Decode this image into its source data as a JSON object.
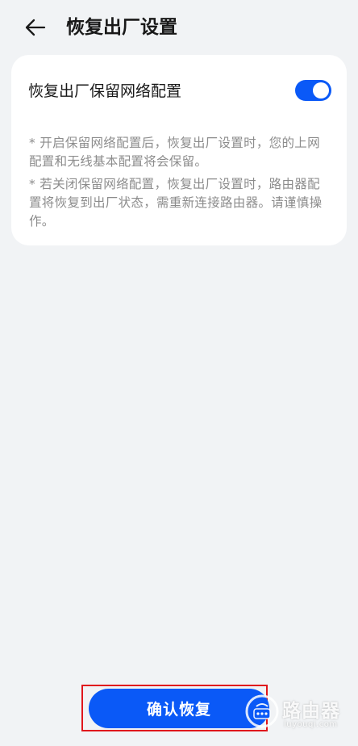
{
  "header": {
    "title": "恢复出厂设置",
    "back_icon": "arrow-left-icon"
  },
  "settings": {
    "keep_network_label": "恢复出厂保留网络配置",
    "keep_network_enabled": true,
    "note_on": "* 开启保留网络配置后，恢复出厂设置时，您的上网配置和无线基本配置将会保留。",
    "note_off": "* 若关闭保留网络配置，恢复出厂设置时，路由器配置将恢复到出厂状态，需重新连接路由器。请谨慎操作。"
  },
  "actions": {
    "confirm_label": "确认恢复"
  },
  "watermark": {
    "text": "路由器",
    "url": "luyouqi.com"
  },
  "colors": {
    "accent": "#0a59f7",
    "background": "#f1f3f5",
    "card": "#ffffff",
    "note_text": "#8c8c8c",
    "highlight": "#e0161c"
  }
}
